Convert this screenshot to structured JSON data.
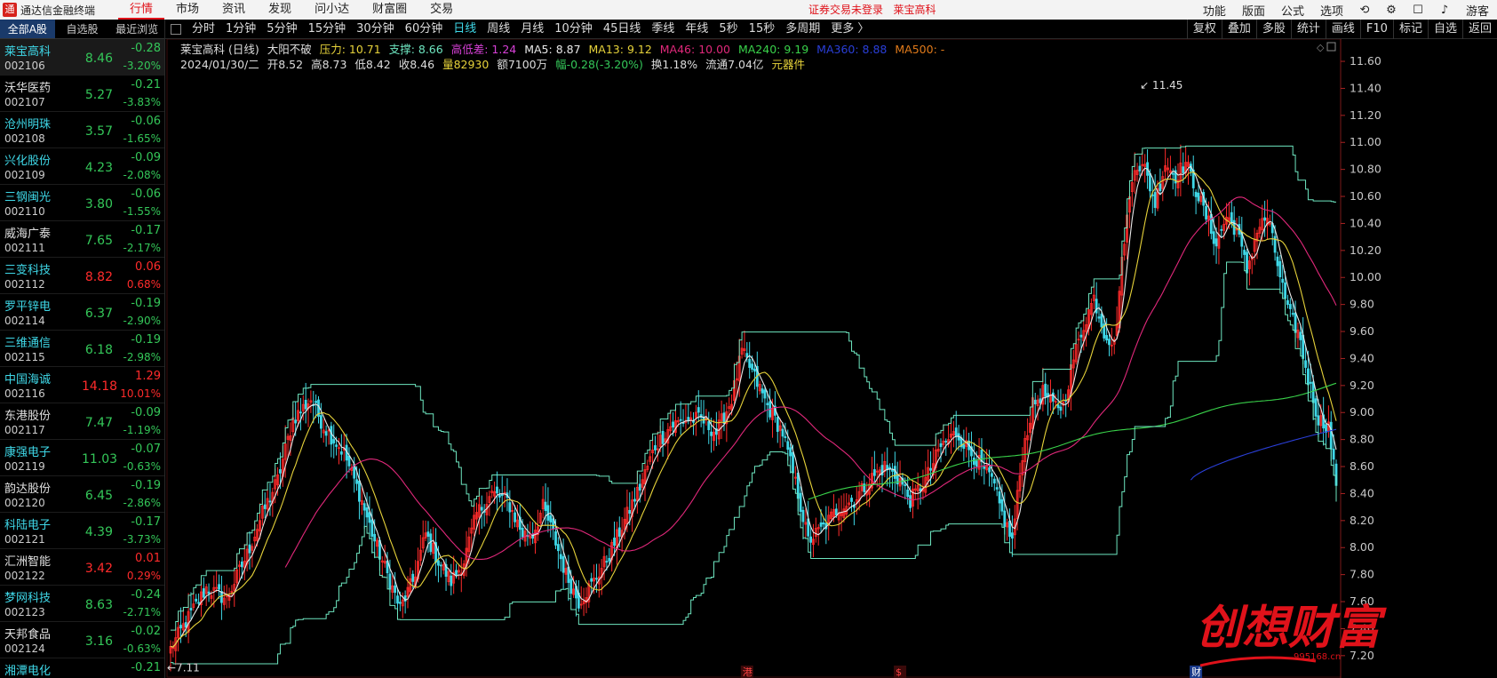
{
  "topbar": {
    "app_name": "通达信金融终端",
    "menus": [
      "行情",
      "市场",
      "资讯",
      "发现",
      "问小达",
      "财富圈",
      "交易"
    ],
    "login_status": "证券交易未登录",
    "current_stock": "莱宝高科",
    "right_buttons": [
      "功能",
      "版面",
      "公式",
      "选项"
    ],
    "guest": "游客"
  },
  "left_tabs": [
    "全部A股",
    "自选股",
    "最近浏览"
  ],
  "stocks": [
    {
      "name": "莱宝高科",
      "code": "002106",
      "price": "8.46",
      "change": "-0.28",
      "pct": "-3.20%",
      "name_color": "c",
      "dir": "g"
    },
    {
      "name": "沃华医药",
      "code": "002107",
      "price": "5.27",
      "change": "-0.21",
      "pct": "-3.83%",
      "name_color": "w",
      "dir": "g"
    },
    {
      "name": "沧州明珠",
      "code": "002108",
      "price": "3.57",
      "change": "-0.06",
      "pct": "-1.65%",
      "name_color": "c",
      "dir": "g"
    },
    {
      "name": "兴化股份",
      "code": "002109",
      "price": "4.23",
      "change": "-0.09",
      "pct": "-2.08%",
      "name_color": "c",
      "dir": "g"
    },
    {
      "name": "三钢闽光",
      "code": "002110",
      "price": "3.80",
      "change": "-0.06",
      "pct": "-1.55%",
      "name_color": "c",
      "dir": "g"
    },
    {
      "name": "威海广泰",
      "code": "002111",
      "price": "7.65",
      "change": "-0.17",
      "pct": "-2.17%",
      "name_color": "w",
      "dir": "g"
    },
    {
      "name": "三变科技",
      "code": "002112",
      "price": "8.82",
      "change": "0.06",
      "pct": "0.68%",
      "name_color": "c",
      "dir": "r"
    },
    {
      "name": "罗平锌电",
      "code": "002114",
      "price": "6.37",
      "change": "-0.19",
      "pct": "-2.90%",
      "name_color": "c",
      "dir": "g"
    },
    {
      "name": "三维通信",
      "code": "002115",
      "price": "6.18",
      "change": "-0.19",
      "pct": "-2.98%",
      "name_color": "c",
      "dir": "g"
    },
    {
      "name": "中国海诚",
      "code": "002116",
      "price": "14.18",
      "change": "1.29",
      "pct": "10.01%",
      "name_color": "c",
      "dir": "r"
    },
    {
      "name": "东港股份",
      "code": "002117",
      "price": "7.47",
      "change": "-0.09",
      "pct": "-1.19%",
      "name_color": "w",
      "dir": "g"
    },
    {
      "name": "康强电子",
      "code": "002119",
      "price": "11.03",
      "change": "-0.07",
      "pct": "-0.63%",
      "name_color": "c",
      "dir": "g"
    },
    {
      "name": "韵达股份",
      "code": "002120",
      "price": "6.45",
      "change": "-0.19",
      "pct": "-2.86%",
      "name_color": "w",
      "dir": "g"
    },
    {
      "name": "科陆电子",
      "code": "002121",
      "price": "4.39",
      "change": "-0.17",
      "pct": "-3.73%",
      "name_color": "c",
      "dir": "g"
    },
    {
      "name": "汇洲智能",
      "code": "002122",
      "price": "3.42",
      "change": "0.01",
      "pct": "0.29%",
      "name_color": "w",
      "dir": "r"
    },
    {
      "name": "梦网科技",
      "code": "002123",
      "price": "8.63",
      "change": "-0.24",
      "pct": "-2.71%",
      "name_color": "c",
      "dir": "g"
    },
    {
      "name": "天邦食品",
      "code": "002124",
      "price": "3.16",
      "change": "-0.02",
      "pct": "-0.63%",
      "name_color": "w",
      "dir": "g"
    },
    {
      "name": "湘潭电化",
      "code": "",
      "price": "",
      "change": "-0.21",
      "pct": "",
      "name_color": "c",
      "dir": "g"
    }
  ],
  "periods": [
    "分时",
    "1分钟",
    "5分钟",
    "15分钟",
    "30分钟",
    "60分钟",
    "日线",
    "周线",
    "月线",
    "10分钟",
    "45日线",
    "季线",
    "年线",
    "5秒",
    "15秒",
    "多周期",
    "更多 〉"
  ],
  "active_period": "日线",
  "right_tools": [
    "复权",
    "叠加",
    "多股",
    "统计",
    "画线",
    "F10",
    "标记",
    "自选",
    "返回"
  ],
  "info": {
    "title": "莱宝高科 (日线)",
    "signal": "大阳不破",
    "pressure": "压力: 10.71",
    "support": "支撑: 8.66",
    "hl_diff": "高低差: 1.24",
    "ma5": "MA5: 8.87",
    "ma13": "MA13: 9.12",
    "ma46": "MA46: 10.00",
    "ma240": "MA240: 9.19",
    "ma360": "MA360: 8.88",
    "ma500": "MA500: -",
    "date": "2024/01/30/二",
    "open": "开8.52",
    "high": "高8.73",
    "low": "低8.42",
    "close": "收8.46",
    "volume": "量82930",
    "amount": "额7100万",
    "range": "幅-0.28(-3.20%)",
    "turnover": "换1.18%",
    "float_cap": "流通7.04亿",
    "sector": "元器件"
  },
  "colors": {
    "up": "#ff2b2b",
    "down": "#3fd8e8",
    "ma5": "#e8e8e8",
    "ma13": "#e6d23a",
    "ma46": "#e0287a",
    "ma240": "#39d24a",
    "ma360": "#2a3fd8",
    "band": "#6ee6c0"
  },
  "chart_data": {
    "type": "candlestick",
    "y_ticks": [
      "11.60",
      "11.40",
      "11.20",
      "11.00",
      "10.80",
      "10.60",
      "10.40",
      "10.20",
      "10.00",
      "9.80",
      "9.60",
      "9.40",
      "9.20",
      "9.00",
      "8.80",
      "8.60",
      "8.40",
      "8.20",
      "8.00",
      "7.80",
      "7.60",
      "7.40",
      "7.20"
    ],
    "ylim": [
      7.12,
      11.62
    ],
    "max_label": "11.45",
    "min_label": "7.11",
    "event_markers": [
      "港",
      "$",
      "财"
    ],
    "watermark": "创想财富",
    "watermark_url": "995168.cn",
    "anchors": [
      [
        0,
        7.25
      ],
      [
        6,
        7.45
      ],
      [
        14,
        7.7
      ],
      [
        22,
        7.62
      ],
      [
        30,
        7.95
      ],
      [
        36,
        8.25
      ],
      [
        42,
        8.5
      ],
      [
        48,
        8.95
      ],
      [
        55,
        9.1
      ],
      [
        60,
        8.9
      ],
      [
        68,
        8.7
      ],
      [
        74,
        8.4
      ],
      [
        80,
        8.05
      ],
      [
        86,
        7.75
      ],
      [
        90,
        7.55
      ],
      [
        95,
        7.75
      ],
      [
        100,
        8.1
      ],
      [
        105,
        7.9
      ],
      [
        110,
        7.75
      ],
      [
        115,
        7.9
      ],
      [
        120,
        8.25
      ],
      [
        126,
        8.4
      ],
      [
        132,
        8.35
      ],
      [
        138,
        8.1
      ],
      [
        142,
        8.1
      ],
      [
        146,
        8.3
      ],
      [
        150,
        8.1
      ],
      [
        155,
        7.8
      ],
      [
        160,
        7.6
      ],
      [
        166,
        7.75
      ],
      [
        172,
        7.95
      ],
      [
        178,
        8.2
      ],
      [
        184,
        8.45
      ],
      [
        190,
        8.75
      ],
      [
        196,
        8.9
      ],
      [
        202,
        8.95
      ],
      [
        208,
        8.95
      ],
      [
        214,
        8.85
      ],
      [
        220,
        9.1
      ],
      [
        224,
        9.45
      ],
      [
        228,
        9.3
      ],
      [
        234,
        9.05
      ],
      [
        240,
        8.85
      ],
      [
        246,
        8.4
      ],
      [
        250,
        8.05
      ],
      [
        256,
        8.15
      ],
      [
        262,
        8.3
      ],
      [
        268,
        8.35
      ],
      [
        274,
        8.5
      ],
      [
        280,
        8.6
      ],
      [
        286,
        8.5
      ],
      [
        290,
        8.35
      ],
      [
        296,
        8.5
      ],
      [
        302,
        8.75
      ],
      [
        308,
        8.85
      ],
      [
        314,
        8.7
      ],
      [
        318,
        8.6
      ],
      [
        322,
        8.5
      ],
      [
        326,
        8.25
      ],
      [
        330,
        8.05
      ],
      [
        334,
        8.7
      ],
      [
        338,
        9.05
      ],
      [
        342,
        9.15
      ],
      [
        346,
        9.05
      ],
      [
        350,
        9.05
      ],
      [
        354,
        9.4
      ],
      [
        358,
        9.65
      ],
      [
        362,
        9.85
      ],
      [
        366,
        9.6
      ],
      [
        370,
        9.5
      ],
      [
        374,
        10.3
      ],
      [
        378,
        10.85
      ],
      [
        382,
        10.8
      ],
      [
        386,
        10.55
      ],
      [
        390,
        10.85
      ],
      [
        394,
        10.75
      ],
      [
        398,
        10.85
      ],
      [
        402,
        10.65
      ],
      [
        406,
        10.45
      ],
      [
        410,
        10.25
      ],
      [
        414,
        10.45
      ],
      [
        418,
        10.35
      ],
      [
        422,
        10.05
      ],
      [
        426,
        10.35
      ],
      [
        430,
        10.45
      ],
      [
        434,
        10.1
      ],
      [
        438,
        9.75
      ],
      [
        442,
        9.6
      ],
      [
        446,
        9.25
      ],
      [
        450,
        8.95
      ],
      [
        454,
        8.9
      ],
      [
        457,
        8.46
      ]
    ]
  }
}
